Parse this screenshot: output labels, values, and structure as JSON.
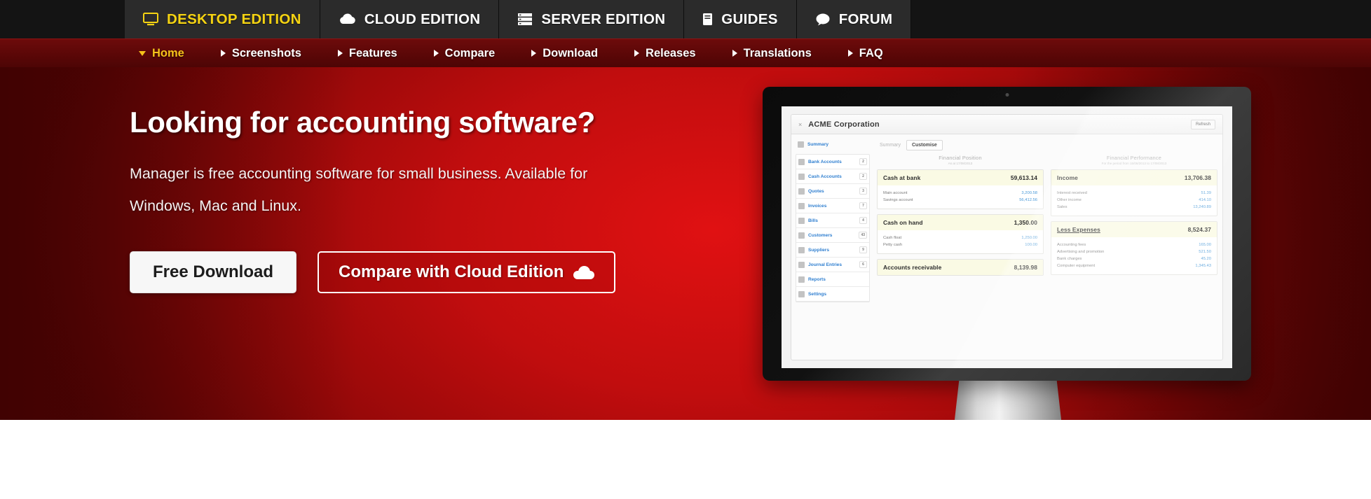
{
  "edition_bar": {
    "tabs": [
      {
        "label": "DESKTOP EDITION",
        "icon": "desktop-monitor-icon",
        "active": true
      },
      {
        "label": "CLOUD EDITION",
        "icon": "cloud-icon",
        "active": false
      },
      {
        "label": "SERVER EDITION",
        "icon": "server-rack-icon",
        "active": false
      },
      {
        "label": "GUIDES",
        "icon": "book-icon",
        "active": false
      },
      {
        "label": "FORUM",
        "icon": "speech-bubble-icon",
        "active": false
      }
    ],
    "active_color": "#f5d312",
    "background": "#141414",
    "tab_background": "#2b2b2b"
  },
  "nav_bar": {
    "background": "#5b0707",
    "active_color": "#f5c21a",
    "items": [
      {
        "label": "Home",
        "marker": "chevron-down-icon",
        "active": true
      },
      {
        "label": "Screenshots",
        "marker": "triangle-right-icon",
        "active": false
      },
      {
        "label": "Features",
        "marker": "triangle-right-icon",
        "active": false
      },
      {
        "label": "Compare",
        "marker": "triangle-right-icon",
        "active": false
      },
      {
        "label": "Download",
        "marker": "triangle-right-icon",
        "active": false
      },
      {
        "label": "Releases",
        "marker": "triangle-right-icon",
        "active": false
      },
      {
        "label": "Translations",
        "marker": "triangle-right-icon",
        "active": false
      },
      {
        "label": "FAQ",
        "marker": "triangle-right-icon",
        "active": false
      }
    ]
  },
  "hero": {
    "headline": "Looking for accounting software?",
    "subhead": "Manager is free accounting software for small business. Available for Windows, Mac and Linux.",
    "accent_red": "#c10d0e",
    "buttons": {
      "primary": "Free Download",
      "secondary": "Compare with Cloud Edition",
      "secondary_icon": "cloud-icon"
    }
  },
  "app_mockup": {
    "company": "ACME Corporation",
    "close_glyph": "×",
    "refresh_label": "Refresh",
    "sidebar": [
      {
        "label": "Summary",
        "badge": ""
      },
      {
        "label": "Bank Accounts",
        "badge": "2"
      },
      {
        "label": "Cash Accounts",
        "badge": "2"
      },
      {
        "label": "Quotes",
        "badge": "3"
      },
      {
        "label": "Invoices",
        "badge": "7"
      },
      {
        "label": "Bills",
        "badge": "4"
      },
      {
        "label": "Customers",
        "badge": "43"
      },
      {
        "label": "Suppliers",
        "badge": "9"
      },
      {
        "label": "Journal Entries",
        "badge": "6"
      },
      {
        "label": "Reports",
        "badge": ""
      },
      {
        "label": "Settings",
        "badge": ""
      }
    ],
    "tabs": {
      "plain": "Summary",
      "button": "Customise"
    },
    "left_panel": {
      "title": "Financial Position",
      "subtitle": "As at 17/08/2013",
      "cards": [
        {
          "title": "Cash at bank",
          "total": "59,613.14",
          "rows": [
            {
              "label": "Main account",
              "amount": "3,200.58"
            },
            {
              "label": "Savings account",
              "amount": "56,412.56"
            }
          ]
        },
        {
          "title": "Cash on hand",
          "total": "1,350.00",
          "rows": [
            {
              "label": "Cash float",
              "amount": "1,250.00"
            },
            {
              "label": "Petty cash",
              "amount": "100.00"
            }
          ]
        },
        {
          "title": "Accounts receivable",
          "total": "8,139.98",
          "rows": []
        }
      ]
    },
    "right_panel": {
      "title": "Financial Performance",
      "subtitle": "For the period from 15/06/2013 to 17/08/2013",
      "cards": [
        {
          "title": "Income",
          "total": "13,706.38",
          "rows": [
            {
              "label": "Interest received",
              "amount": "51.39"
            },
            {
              "label": "Other income",
              "amount": "414.10"
            },
            {
              "label": "Sales",
              "amount": "13,240.89"
            }
          ]
        },
        {
          "title": "Less Expenses",
          "total": "8,524.37",
          "rows": [
            {
              "label": "Accounting fees",
              "amount": "165.00"
            },
            {
              "label": "Advertising and promotion",
              "amount": "521.50"
            },
            {
              "label": "Bank charges",
              "amount": "45.20"
            },
            {
              "label": "Computer equipment",
              "amount": "1,345.43"
            }
          ]
        }
      ]
    }
  }
}
